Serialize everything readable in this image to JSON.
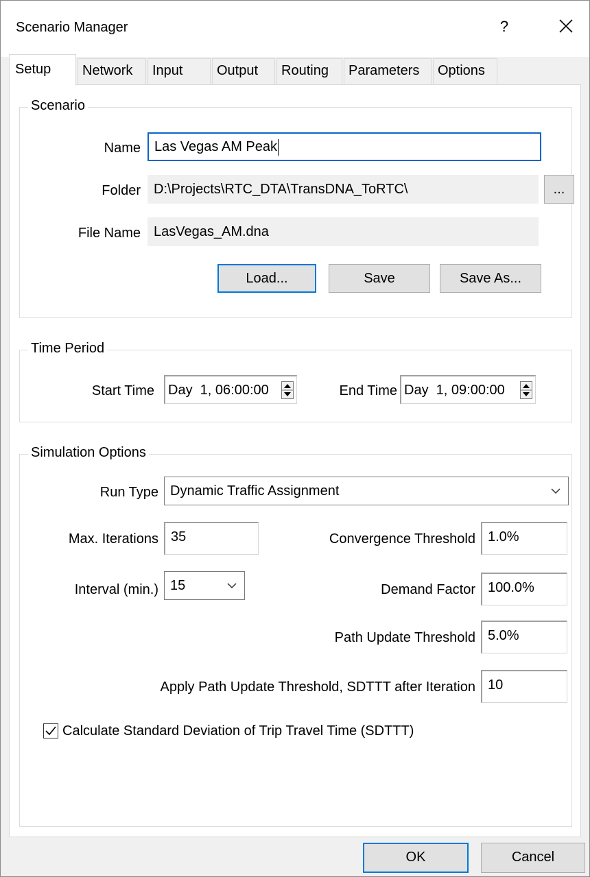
{
  "window": {
    "title": "Scenario Manager",
    "help_glyph": "?"
  },
  "tabs": [
    {
      "label": "Setup"
    },
    {
      "label": "Network"
    },
    {
      "label": "Input"
    },
    {
      "label": "Output"
    },
    {
      "label": "Routing"
    },
    {
      "label": "Parameters"
    },
    {
      "label": "Options"
    }
  ],
  "scenario": {
    "group_title": "Scenario",
    "name_label": "Name",
    "name_value": "Las Vegas AM Peak",
    "folder_label": "Folder",
    "folder_value": "D:\\Projects\\RTC_DTA\\TransDNA_ToRTC\\",
    "browse_label": "...",
    "file_label": "File Name",
    "file_value": "LasVegas_AM.dna",
    "load_label": "Load...",
    "save_label": "Save",
    "save_as_label": "Save As..."
  },
  "time_period": {
    "group_title": "Time Period",
    "start_label": "Start Time",
    "start_value": "Day  1, 06:00:00",
    "end_label": "End Time",
    "end_value": "Day  1, 09:00:00"
  },
  "simulation": {
    "group_title": "Simulation Options",
    "run_type_label": "Run Type",
    "run_type_value": "Dynamic Traffic Assignment",
    "max_iter_label": "Max. Iterations",
    "max_iter_value": "35",
    "convergence_label": "Convergence Threshold",
    "convergence_value": "1.0%",
    "interval_label": "Interval (min.)",
    "interval_value": "15",
    "demand_label": "Demand Factor",
    "demand_value": "100.0%",
    "path_update_label": "Path Update Threshold",
    "path_update_value": "5.0%",
    "apply_after_label": "Apply Path Update Threshold, SDTTT after Iteration",
    "apply_after_value": "10",
    "sdttt_label": "Calculate Standard Deviation of Trip Travel Time (SDTTT)",
    "sdttt_checked": true
  },
  "footer": {
    "ok_label": "OK",
    "cancel_label": "Cancel"
  },
  "colors": {
    "focus_border": "#0a64c8",
    "default_button_border": "#0078d7",
    "dialog_bg": "#f0f0f0",
    "panel_bg": "#ffffff"
  }
}
